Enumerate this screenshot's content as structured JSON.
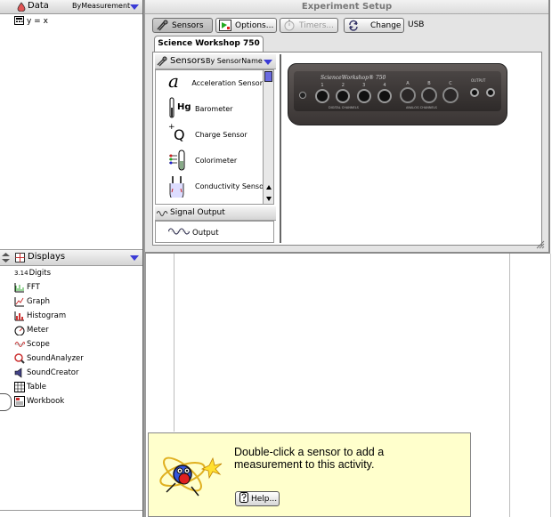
{
  "data_panel": {
    "title": "Data",
    "sort_label": "ByMeasurement",
    "items": [
      {
        "label": "y = x",
        "icon": "calculator-icon"
      }
    ]
  },
  "displays_panel": {
    "title": "Displays",
    "items": [
      {
        "label": "Digits",
        "icon": "digits-icon",
        "icon_text": "3.14"
      },
      {
        "label": "FFT",
        "icon": "fft-icon"
      },
      {
        "label": "Graph",
        "icon": "graph-icon"
      },
      {
        "label": "Histogram",
        "icon": "histogram-icon"
      },
      {
        "label": "Meter",
        "icon": "meter-icon"
      },
      {
        "label": "Scope",
        "icon": "scope-icon"
      },
      {
        "label": "SoundAnalyzer",
        "icon": "sound-analyzer-icon"
      },
      {
        "label": "SoundCreator",
        "icon": "sound-creator-icon"
      },
      {
        "label": "Table",
        "icon": "table-icon"
      },
      {
        "label": "Workbook",
        "icon": "workbook-icon"
      }
    ]
  },
  "experiment_setup": {
    "title": "Experiment Setup",
    "toolbar": {
      "sensors_label": "Sensors",
      "options_label": "Options...",
      "timers_label": "Timers...",
      "change_label": "Change",
      "connection": "USB"
    },
    "interface_tab": "Science Workshop 750",
    "sensors_list": {
      "title": "Sensors",
      "sort_label": "By SensorName",
      "items": [
        {
          "label": "Acceleration Sensor",
          "icon": "acceleration-sensor-icon",
          "icon_text": "a"
        },
        {
          "label": "Barometer",
          "icon": "barometer-icon",
          "icon_text": "Hg"
        },
        {
          "label": "Charge Sensor",
          "icon": "charge-sensor-icon",
          "icon_text": "Q"
        },
        {
          "label": "Colorimeter",
          "icon": "colorimeter-icon"
        },
        {
          "label": "Conductivity Sensor",
          "icon": "conductivity-sensor-icon"
        }
      ]
    },
    "signal_output": {
      "title": "Signal Output",
      "items": [
        {
          "label": "Output",
          "icon": "output-wave-icon"
        }
      ]
    },
    "device": {
      "brand": "ScienceWorkshop® 750",
      "digital_label": "DIGITAL CHANNELS",
      "analog_label": "ANALOG CHANNELS",
      "output_label": "OUTPUT",
      "digital_channels": [
        "1",
        "2",
        "3",
        "4"
      ],
      "analog_channels": [
        "A",
        "B",
        "C"
      ]
    }
  },
  "assistant": {
    "message": "Double-click a sensor to add a measurement to this activity.",
    "help_label": "Help..."
  },
  "colors": {
    "accent_blue": "#3b3bd6",
    "assistant_bg": "#ffffcc",
    "window_bg": "#e4e4e4"
  }
}
